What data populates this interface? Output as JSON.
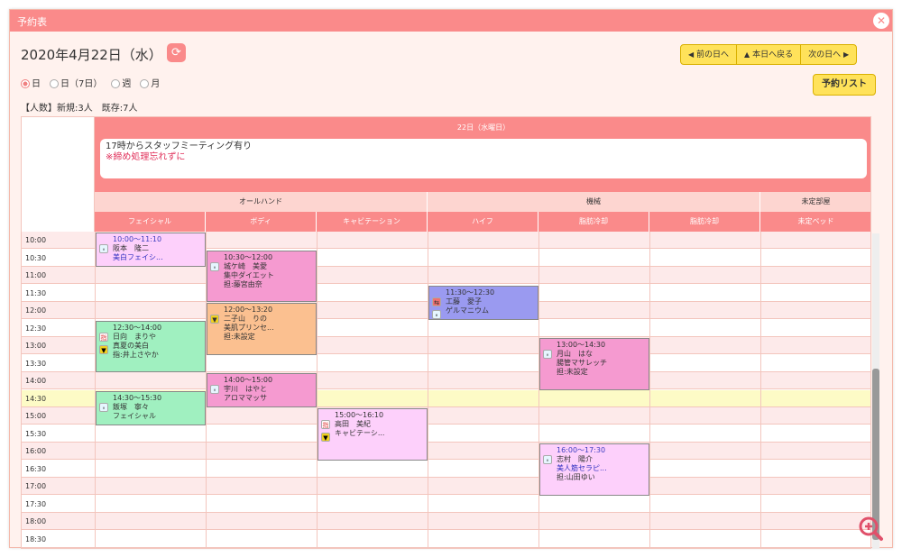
{
  "window": {
    "title": "予約表",
    "close_icon": "close-icon"
  },
  "header": {
    "date_title": "2020年4月22日（水）",
    "refresh_icon": "refresh-icon",
    "nav": {
      "prev": "前の日へ",
      "today": "本日へ戻る",
      "next": "次の日へ"
    },
    "list_button": "予約リスト"
  },
  "view_options": [
    {
      "label": "日",
      "selected": true
    },
    {
      "label": "日（7日）",
      "selected": false
    },
    {
      "label": "週",
      "selected": false
    },
    {
      "label": "月",
      "selected": false
    }
  ],
  "counts": "【人数】新規:3人　既存:7人",
  "day": {
    "label": "22日（水曜日）",
    "memo_line1": "17時からスタッフミーティング有り",
    "memo_line2": "※締め処理忘れずに"
  },
  "groups": [
    {
      "label": "オールハンド",
      "span": 3
    },
    {
      "label": "機械",
      "span": 3
    },
    {
      "label": "未定部屋",
      "span": 1
    }
  ],
  "columns": [
    "フェイシャル",
    "ボディ",
    "キャビテーション",
    "ハイフ",
    "脂肪冷却",
    "脂肪冷却",
    "未定ベッド"
  ],
  "times": [
    "10:00",
    "10:30",
    "11:00",
    "11:30",
    "12:00",
    "12:30",
    "13:00",
    "13:30",
    "14:00",
    "14:30",
    "15:00",
    "15:30",
    "16:00",
    "16:30",
    "17:00",
    "17:30",
    "18:00",
    "18:30"
  ],
  "current_time": "14:30",
  "events": [
    {
      "col": 0,
      "start": 0,
      "slots": 2,
      "color": "#fdd0fb",
      "icon": "user-icon",
      "icon2": "",
      "time": "10:00〜11:10",
      "name": "阪本　隆二",
      "service": "美白フェイシ...",
      "staff": "",
      "time_color": "#4040c0",
      "service_color": "#3030c0"
    },
    {
      "col": 1,
      "start": 1,
      "slots": 3,
      "color": "#f59ad0",
      "icon": "user-icon",
      "icon2": "",
      "time": "10:30〜12:00",
      "name": "城ケ崎　美愛",
      "service": "集中ダイエット",
      "staff": "担:藤宮由奈",
      "time_color": "#333",
      "service_color": "#333"
    },
    {
      "col": 3,
      "start": 3,
      "slots": 2,
      "color": "#9a9af0",
      "icon": "repeat-icon",
      "icon2": "user-icon",
      "time": "11:30〜12:30",
      "name": "工藤　愛子",
      "service": "ゲルマニウム",
      "staff": "",
      "time_color": "#333",
      "service_color": "#333"
    },
    {
      "col": 1,
      "start": 4,
      "slots": 3,
      "color": "#fbc090",
      "icon": "beginner-icon",
      "icon2": "",
      "time": "12:00〜13:20",
      "name": "二子山　りの",
      "service": "美肌プリンセ...",
      "staff": "担:未設定",
      "time_color": "#333",
      "service_color": "#333"
    },
    {
      "col": 0,
      "start": 5,
      "slots": 3,
      "color": "#a0f0c0",
      "icon": "designated-icon",
      "icon2": "beginner-icon",
      "time": "12:30〜14:00",
      "name": "日向　まりや",
      "service": "真夏の美白",
      "staff": "指:井上さやか",
      "time_color": "#333",
      "service_color": "#333"
    },
    {
      "col": 4,
      "start": 6,
      "slots": 3,
      "color": "#f59ad0",
      "icon": "user-icon",
      "icon2": "",
      "time": "13:00〜14:30",
      "name": "月山　はな",
      "service": "腸管マサレッチ",
      "staff": "担:未設定",
      "time_color": "#333",
      "service_color": "#333"
    },
    {
      "col": 1,
      "start": 8,
      "slots": 2,
      "color": "#f59ad0",
      "icon": "user-icon",
      "icon2": "",
      "time": "14:00〜15:00",
      "name": "宇川　はやと",
      "service": "アロママッサ",
      "staff": "",
      "time_color": "#333",
      "service_color": "#333"
    },
    {
      "col": 0,
      "start": 9,
      "slots": 2,
      "color": "#a0f0c0",
      "icon": "user-icon",
      "icon2": "",
      "time": "14:30〜15:30",
      "name": "飯塚　寧々",
      "service": "フェイシャル",
      "staff": "",
      "time_color": "#333",
      "service_color": "#333"
    },
    {
      "col": 2,
      "start": 10,
      "slots": 3,
      "color": "#fdd0fb",
      "icon": "designated-icon",
      "icon2": "beginner-icon",
      "time": "15:00〜16:10",
      "name": "高田　美紀",
      "service": "キャビテーシ...",
      "staff": "",
      "time_color": "#333",
      "service_color": "#333"
    },
    {
      "col": 4,
      "start": 12,
      "slots": 3,
      "color": "#fdd0fb",
      "icon": "user-icon",
      "icon2": "",
      "time": "16:00〜17:30",
      "name": "志村　陽介",
      "service": "美人筋セラピ...",
      "staff": "担:山田ゆい",
      "time_color": "#4040c0",
      "service_color": "#3030c0"
    }
  ],
  "zoom_icon": "zoom-in-icon"
}
